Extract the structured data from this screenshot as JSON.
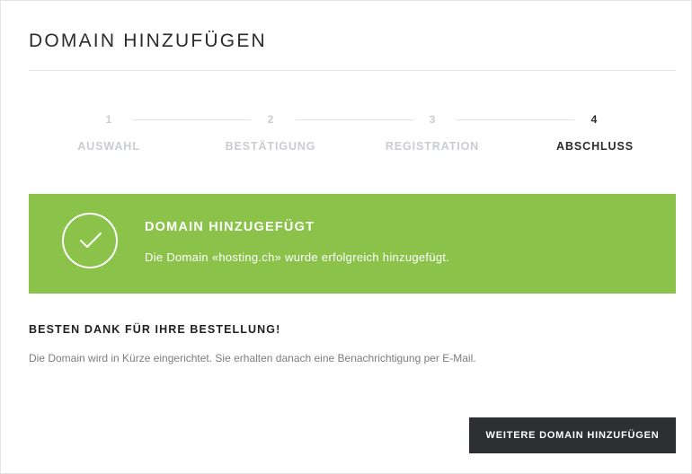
{
  "page": {
    "title": "DOMAIN HINZUFÜGEN"
  },
  "stepper": {
    "steps": [
      {
        "number": "1",
        "label": "AUSWAHL",
        "active": false
      },
      {
        "number": "2",
        "label": "BESTÄTIGUNG",
        "active": false
      },
      {
        "number": "3",
        "label": "REGISTRATION",
        "active": false
      },
      {
        "number": "4",
        "label": "ABSCHLUSS",
        "active": true
      }
    ]
  },
  "banner": {
    "icon": "checkmark-icon",
    "title": "DOMAIN HINZUGEFÜGT",
    "text": "Die Domain «hosting.ch» wurde erfolgreich hinzugefügt.",
    "color": "#8bc34a"
  },
  "confirmation": {
    "heading": "BESTEN DANK FÜR IHRE BESTELLUNG!",
    "text": "Die Domain wird in Kürze eingerichtet. Sie erhalten danach eine Benachrichtigung per E-Mail."
  },
  "actions": {
    "add_more_label": "WEITERE DOMAIN HINZUFÜGEN",
    "button_color": "#2d2f33"
  }
}
